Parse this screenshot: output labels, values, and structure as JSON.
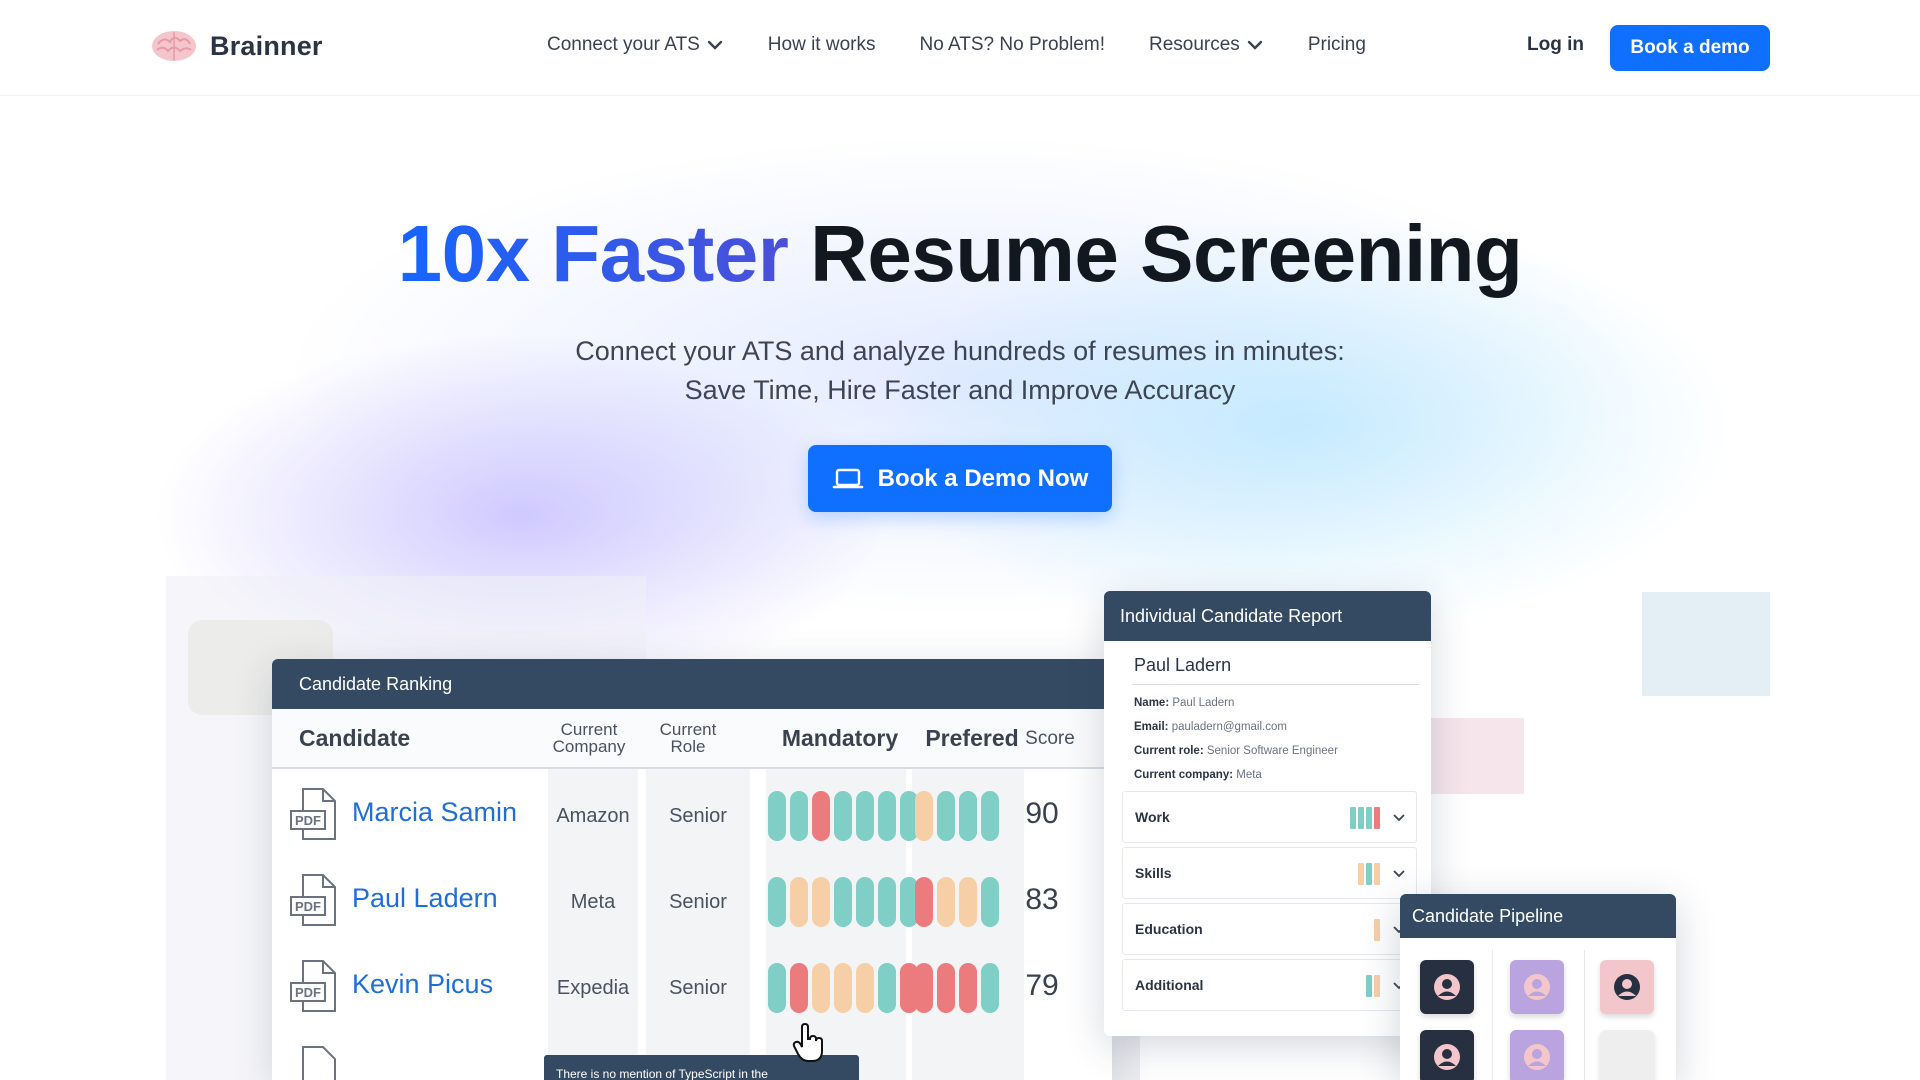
{
  "nav": {
    "brand": "Brainner",
    "links": [
      {
        "label": "Connect your ATS",
        "dropdown": true
      },
      {
        "label": "How it works",
        "dropdown": false
      },
      {
        "label": "No ATS? No Problem!",
        "dropdown": false
      },
      {
        "label": "Resources",
        "dropdown": true
      },
      {
        "label": "Pricing",
        "dropdown": false
      }
    ],
    "login": "Log in",
    "cta": "Book a demo"
  },
  "hero": {
    "title_accent": "10x Faster",
    "title_rest": "Resume Screening",
    "subtitle_line1": "Connect your ATS and analyze hundreds of resumes in minutes:",
    "subtitle_line2": "Save Time, Hire Faster and Improve Accuracy",
    "cta": "Book a Demo Now"
  },
  "ranking": {
    "title": "Candidate Ranking",
    "columns": {
      "candidate": "Candidate",
      "company_l1": "Current",
      "company_l2": "Company",
      "role_l1": "Current",
      "role_l2": "Role",
      "mandatory": "Mandatory",
      "preferred": "Prefered",
      "score": "Score"
    },
    "rows": [
      {
        "name": "Marcia Samin",
        "company": "Amazon",
        "role": "Senior",
        "score": "90",
        "mandatory": [
          "teal",
          "teal",
          "red",
          "teal",
          "teal",
          "teal",
          "teal"
        ],
        "preferred": [
          "peach",
          "teal",
          "teal",
          "teal"
        ]
      },
      {
        "name": "Paul Ladern",
        "company": "Meta",
        "role": "Senior",
        "score": "83",
        "mandatory": [
          "teal",
          "peach",
          "peach",
          "teal",
          "teal",
          "teal",
          "teal"
        ],
        "preferred": [
          "red",
          "peach",
          "peach",
          "teal"
        ]
      },
      {
        "name": "Kevin Picus",
        "company": "Expedia",
        "role": "Senior",
        "score": "79",
        "mandatory": [
          "teal",
          "red",
          "peach",
          "peach",
          "peach",
          "teal",
          "red"
        ],
        "preferred": [
          "red",
          "red",
          "red",
          "teal"
        ]
      }
    ],
    "pdf_label": "PDF",
    "tooltip": "There is no mention of TypeScript in the"
  },
  "report": {
    "title": "Individual Candidate Report",
    "name": "Paul Ladern",
    "fields": [
      {
        "key": "Name:",
        "value": "Paul Ladern"
      },
      {
        "key": "Email:",
        "value": "pauladern@gmail.com"
      },
      {
        "key": "Current role:",
        "value": "Senior Software Engineer"
      },
      {
        "key": "Current company:",
        "value": "Meta"
      }
    ],
    "sections": [
      {
        "label": "Work",
        "bars": [
          "teal",
          "teal",
          "teal",
          "red"
        ]
      },
      {
        "label": "Skills",
        "bars": [
          "peach",
          "teal",
          "peach"
        ]
      },
      {
        "label": "Education",
        "bars": [
          "peach"
        ]
      },
      {
        "label": "Additional",
        "bars": [
          "teal",
          "peach"
        ]
      }
    ]
  },
  "pipeline": {
    "title": "Candidate Pipeline"
  },
  "colors": {
    "accent": "#0f6fff",
    "card_header": "#344a62",
    "teal": "#7fcfc6",
    "red": "#ec7b7d",
    "peach": "#f6cfa7"
  }
}
